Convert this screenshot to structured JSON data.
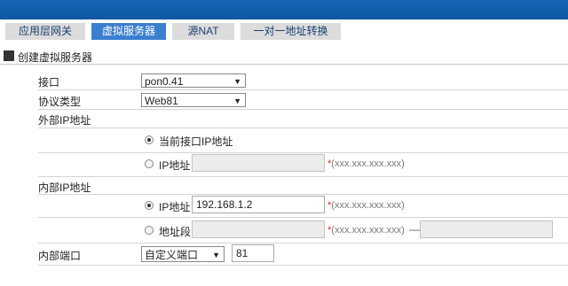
{
  "tabs": [
    {
      "label": "应用层网关"
    },
    {
      "label": "虚拟服务器"
    },
    {
      "label": "源NAT"
    },
    {
      "label": "一对一地址转换"
    }
  ],
  "section": {
    "title": "创建虚拟服务器"
  },
  "form": {
    "interface": {
      "label": "接口",
      "value": "pon0.41"
    },
    "protocol": {
      "label": "协议类型",
      "value": "Web81"
    },
    "external_ip": {
      "label": "外部IP地址",
      "option_current": "当前接口IP地址",
      "option_ip": "IP地址",
      "ip_value": "",
      "hint_star": "*",
      "hint": "(xxx.xxx.xxx.xxx)"
    },
    "internal_ip": {
      "label": "内部IP地址",
      "option_ip": "IP地址",
      "ip_value": "192.168.1.2",
      "hint_star": "*",
      "hint": "(xxx.xxx.xxx.xxx)",
      "option_range": "地址段",
      "range_hint_star": "*",
      "range_hint": "(xxx.xxx.xxx.xxx)",
      "range_dash": "—"
    },
    "internal_port": {
      "label": "内部端口",
      "mode": "自定义端口",
      "value": "81"
    }
  },
  "colors": {
    "topbar": "#1565b8",
    "active_tab": "#3b7fd0",
    "required_star": "#dd2222"
  }
}
